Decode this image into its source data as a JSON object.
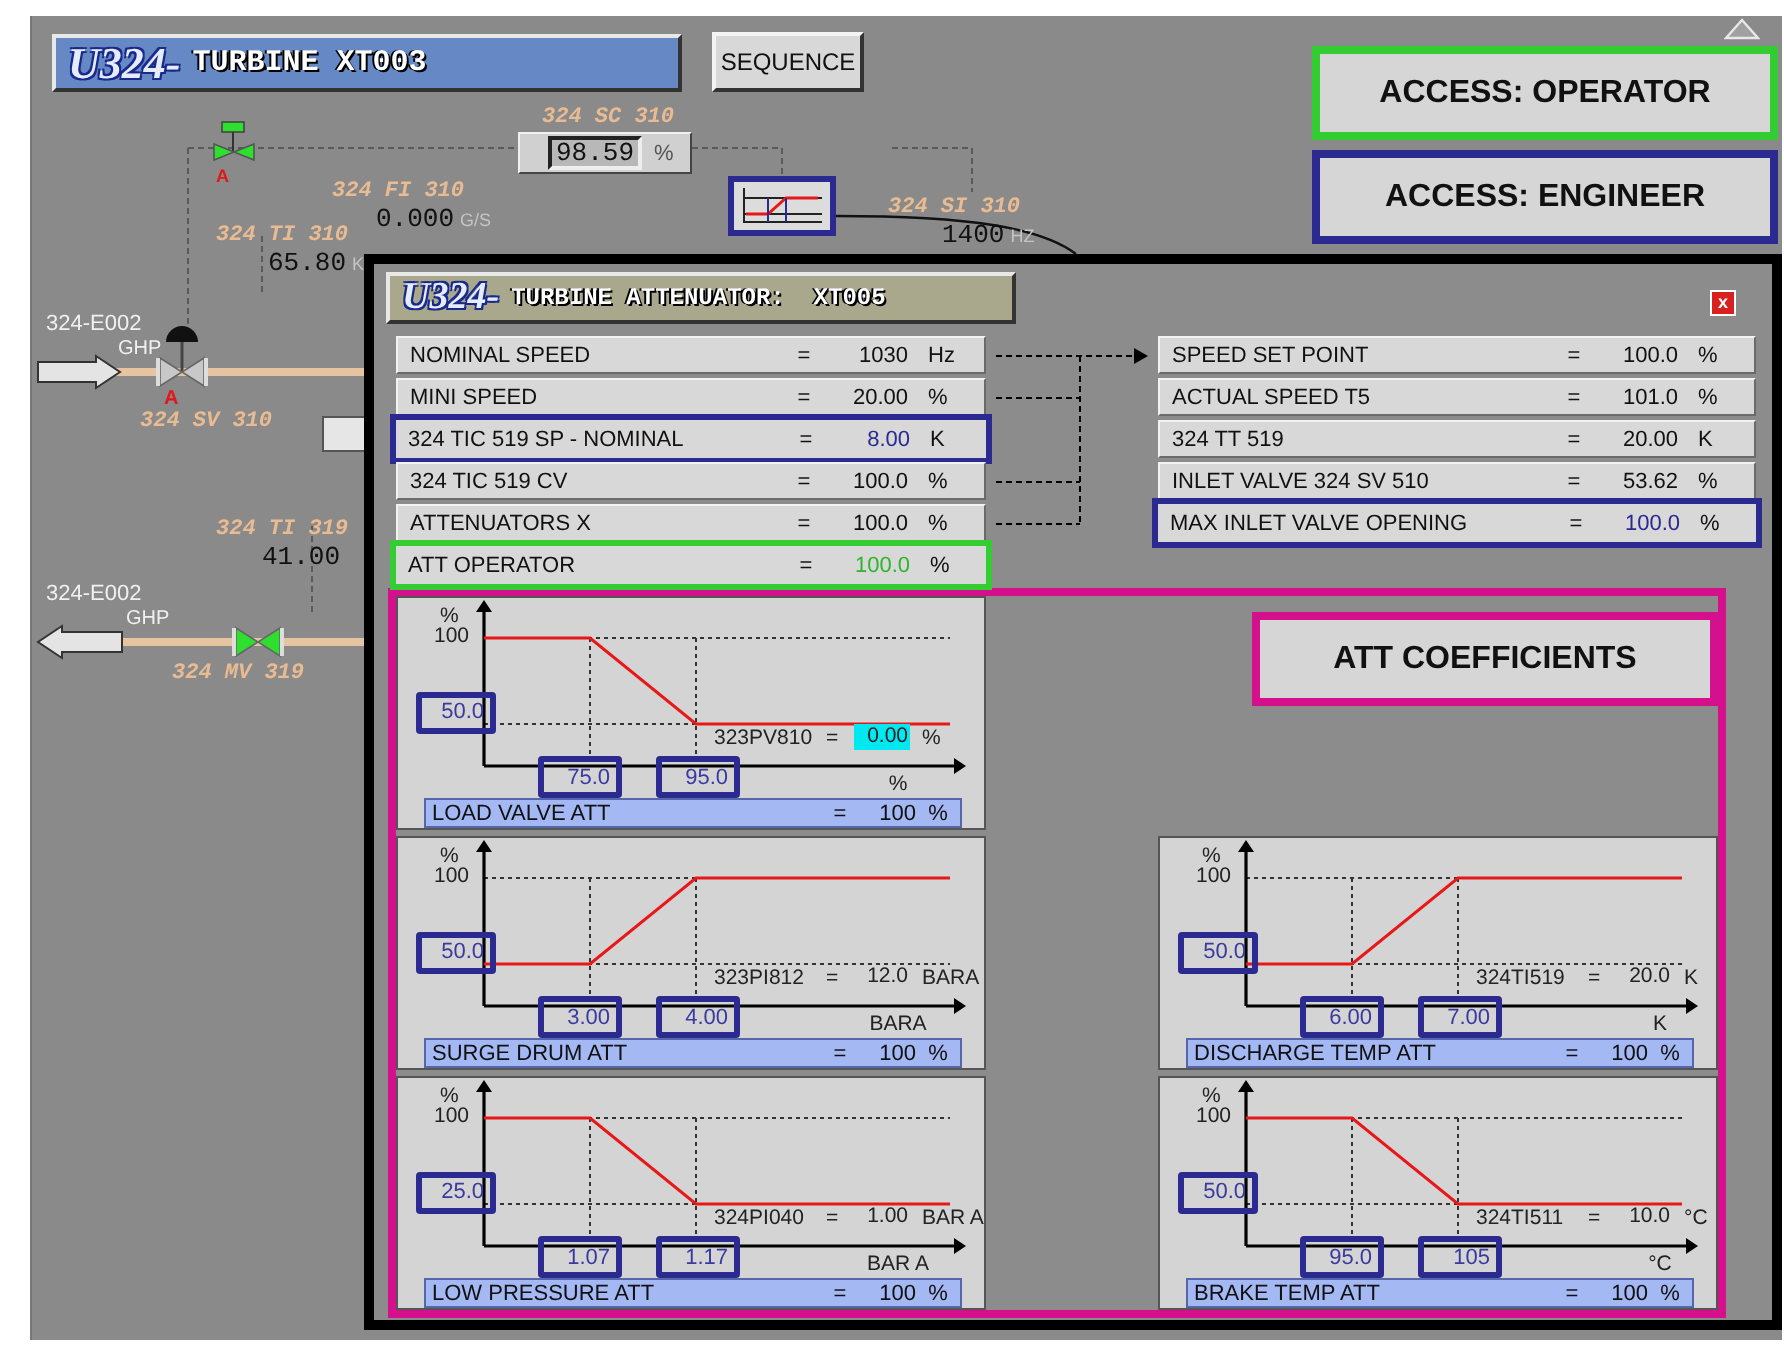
{
  "header": {
    "unit": "U324-",
    "title": "TURBINE XT003"
  },
  "sequence_button": "SEQUENCE",
  "access_levels": [
    {
      "kind": "operator",
      "label": "ACCESS: OPERATOR"
    },
    {
      "kind": "engineer",
      "label": "ACCESS: ENGINEER"
    }
  ],
  "diagram": {
    "top_valve": {
      "open": true,
      "mode": "A"
    },
    "speed_controller": {
      "tag": "324 SC 310",
      "value": "98.59",
      "unit": "%"
    },
    "measurements": [
      {
        "tag": "324 FI 310",
        "value": "0.000",
        "unit": "G/S"
      },
      {
        "tag": "324 TI 310",
        "value": "65.80",
        "unit": "K"
      },
      {
        "tag": "324 SI 310",
        "value": "1400",
        "unit": "HZ"
      },
      {
        "tag": "324 TI 319",
        "value": "41.00"
      }
    ],
    "lines": [
      {
        "kind": "inlet",
        "source": "324-E002",
        "medium": "GHP",
        "valve": {
          "kind": "control",
          "open": false,
          "mode": "A",
          "tag": "324 SV 310"
        }
      },
      {
        "kind": "outlet",
        "source": "324-E002",
        "medium": "GHP",
        "valve": {
          "kind": "manual",
          "open": true,
          "tag": "324 MV 319"
        }
      }
    ]
  },
  "popup": {
    "unit": "U324-",
    "title": "TURBINE ATTENUATOR:  XT005",
    "close": "x",
    "left_rows": [
      {
        "kind": "plain",
        "label": "NOMINAL SPEED",
        "sign": "=",
        "value": "1030",
        "unit": "Hz"
      },
      {
        "kind": "plain",
        "label": "MINI SPEED",
        "sign": "=",
        "value": "20.00",
        "unit": "%"
      },
      {
        "kind": "engineer",
        "label": "324 TIC 519 SP - NOMINAL",
        "sign": "=",
        "value": "8.00",
        "unit": "K"
      },
      {
        "kind": "plain",
        "label": "324 TIC 519 CV",
        "sign": "=",
        "value": "100.0",
        "unit": "%"
      },
      {
        "kind": "plain",
        "label": "ATTENUATORS X",
        "sign": "=",
        "value": "100.0",
        "unit": "%"
      },
      {
        "kind": "operator",
        "label": "ATT OPERATOR",
        "sign": "=",
        "value": "100.0",
        "unit": "%"
      }
    ],
    "right_rows": [
      {
        "kind": "plain",
        "label": "SPEED SET POINT",
        "sign": "=",
        "value": "100.0",
        "unit": "%"
      },
      {
        "kind": "plain",
        "label": "ACTUAL SPEED T5",
        "sign": "=",
        "value": "101.0",
        "unit": "%"
      },
      {
        "kind": "plain",
        "label": "324 TT 519",
        "sign": "=",
        "value": "20.00",
        "unit": "K"
      },
      {
        "kind": "plain",
        "label": "INLET VALVE 324 SV 510",
        "sign": "=",
        "value": "53.62",
        "unit": "%"
      },
      {
        "kind": "engineer",
        "label": "MAX INLET VALVE OPENING",
        "sign": "=",
        "value": "100.0",
        "unit": "%"
      }
    ],
    "coefficients_title": "ATT COEFFICIENTS",
    "charts": [
      {
        "kind": "falling",
        "y_unit": "%",
        "y_max": "100",
        "y_min": "50.0",
        "x_low": "75.0",
        "x_high": "95.0",
        "x_unit": "%",
        "reading": {
          "tag": "323PV810",
          "sign": "=",
          "value": "0.00",
          "unit": "%",
          "highlighted": true
        },
        "result": {
          "label": "LOAD VALVE ATT",
          "sign": "=",
          "value": "100",
          "unit": "%"
        }
      },
      {
        "kind": "rising",
        "y_unit": "%",
        "y_max": "100",
        "y_min": "50.0",
        "x_low": "3.00",
        "x_high": "4.00",
        "x_unit": "BARA",
        "reading": {
          "tag": "323PI812",
          "sign": "=",
          "value": "12.0",
          "unit": "BARA",
          "highlighted": false
        },
        "result": {
          "label": "SURGE DRUM ATT",
          "sign": "=",
          "value": "100",
          "unit": "%"
        }
      },
      {
        "kind": "falling",
        "y_unit": "%",
        "y_max": "100",
        "y_min": "25.0",
        "x_low": "1.07",
        "x_high": "1.17",
        "x_unit": "BAR A",
        "reading": {
          "tag": "324PI040",
          "sign": "=",
          "value": "1.00",
          "unit": "BAR A",
          "highlighted": false
        },
        "result": {
          "label": "LOW PRESSURE ATT",
          "sign": "=",
          "value": "100",
          "unit": "%"
        }
      },
      {
        "kind": "rising",
        "y_unit": "%",
        "y_max": "100",
        "y_min": "50.0",
        "x_low": "6.00",
        "x_high": "7.00",
        "x_unit": "K",
        "reading": {
          "tag": "324TI519",
          "sign": "=",
          "value": "20.0",
          "unit": "K",
          "highlighted": false
        },
        "result": {
          "label": "DISCHARGE TEMP ATT",
          "sign": "=",
          "value": "100",
          "unit": "%"
        }
      },
      {
        "kind": "falling",
        "y_unit": "%",
        "y_max": "100",
        "y_min": "50.0",
        "x_low": "95.0",
        "x_high": "105",
        "x_unit": "°C",
        "reading": {
          "tag": "324TI511",
          "sign": "=",
          "value": "10.0",
          "unit": "°C",
          "highlighted": false
        },
        "result": {
          "label": "BRAKE TEMP ATT",
          "sign": "=",
          "value": "100",
          "unit": "%"
        }
      }
    ]
  }
}
